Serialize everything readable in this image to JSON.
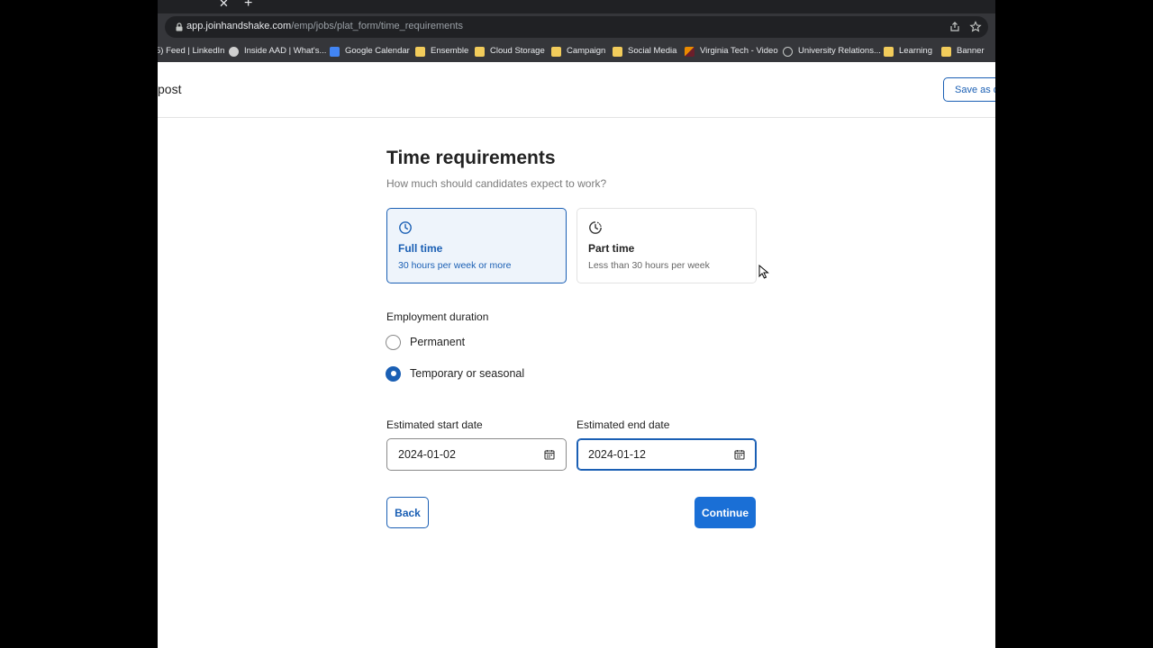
{
  "browser": {
    "tab_close": "✕",
    "new_tab": "+",
    "url_host": "app.joinhandshake.com",
    "url_path": "/emp/jobs/plat_form/time_requirements",
    "bookmarks": [
      {
        "label": "5) Feed | LinkedIn",
        "icon": "none"
      },
      {
        "label": "Inside AAD | What's...",
        "icon": "wp"
      },
      {
        "label": "Google Calendar",
        "icon": "gcal"
      },
      {
        "label": "Ensemble",
        "icon": "folder"
      },
      {
        "label": "Cloud Storage",
        "icon": "folder"
      },
      {
        "label": "Campaign",
        "icon": "folder"
      },
      {
        "label": "Social Media",
        "icon": "folder"
      },
      {
        "label": "Virginia Tech - Video",
        "icon": "vt"
      },
      {
        "label": "University Relations...",
        "icon": "globe"
      },
      {
        "label": "Learning",
        "icon": "folder"
      },
      {
        "label": "Banner",
        "icon": "folder"
      }
    ]
  },
  "header": {
    "title": "post",
    "save_draft_label": "Save as d"
  },
  "page": {
    "title": "Time requirements",
    "subtitle": "How much should candidates expect to work?"
  },
  "time_options": [
    {
      "title": "Full time",
      "subtitle": "30 hours per week or more",
      "selected": true
    },
    {
      "title": "Part time",
      "subtitle": "Less than 30 hours per week",
      "selected": false
    }
  ],
  "employment_duration": {
    "label": "Employment duration",
    "options": [
      {
        "label": "Permanent",
        "checked": false
      },
      {
        "label": "Temporary or seasonal",
        "checked": true
      }
    ]
  },
  "dates": {
    "start_label": "Estimated start date",
    "start_value": "2024-01-02",
    "end_label": "Estimated end date",
    "end_value": "2024-01-12"
  },
  "actions": {
    "back_label": "Back",
    "continue_label": "Continue"
  },
  "colors": {
    "accent": "#1a5fb4",
    "primary_button": "#1a6fd6",
    "selected_card_bg": "#eef4fb"
  }
}
